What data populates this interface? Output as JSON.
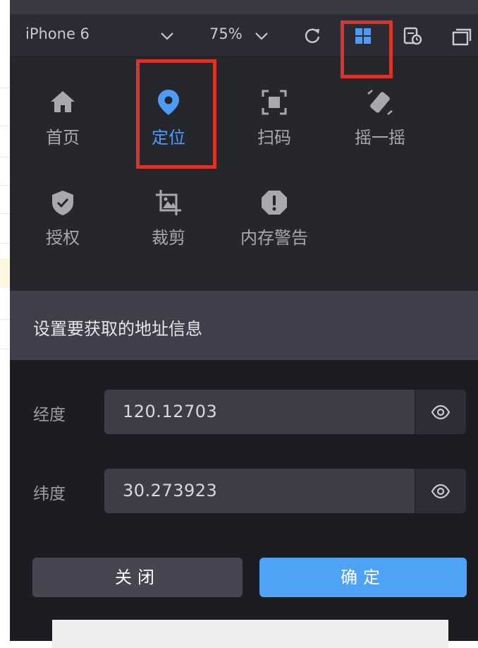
{
  "toolbar": {
    "device": "iPhone 6",
    "zoom": "75%",
    "icons": [
      "chevron-down-icon",
      "refresh-icon",
      "grid-icon",
      "storage-clock-icon",
      "windows-icon"
    ]
  },
  "apis": [
    {
      "label": "首页",
      "icon": "home-icon"
    },
    {
      "label": "定位",
      "icon": "location-pin-icon",
      "active": true
    },
    {
      "label": "扫码",
      "icon": "scan-icon"
    },
    {
      "label": "摇一摇",
      "icon": "shake-phone-icon"
    },
    {
      "label": "授权",
      "icon": "shield-check-icon"
    },
    {
      "label": "裁剪",
      "icon": "crop-image-icon"
    },
    {
      "label": "内存警告",
      "icon": "warning-icon"
    }
  ],
  "dialog": {
    "title": "设置要获取的地址信息",
    "longitude_label": "经度",
    "longitude_value": "120.12703",
    "latitude_label": "纬度",
    "latitude_value": "30.273923",
    "close_label": "关闭",
    "confirm_label": "确定"
  },
  "colors": {
    "accent": "#4d9af7",
    "annotation": "#d9342a",
    "confirm": "#4fa3f7"
  }
}
